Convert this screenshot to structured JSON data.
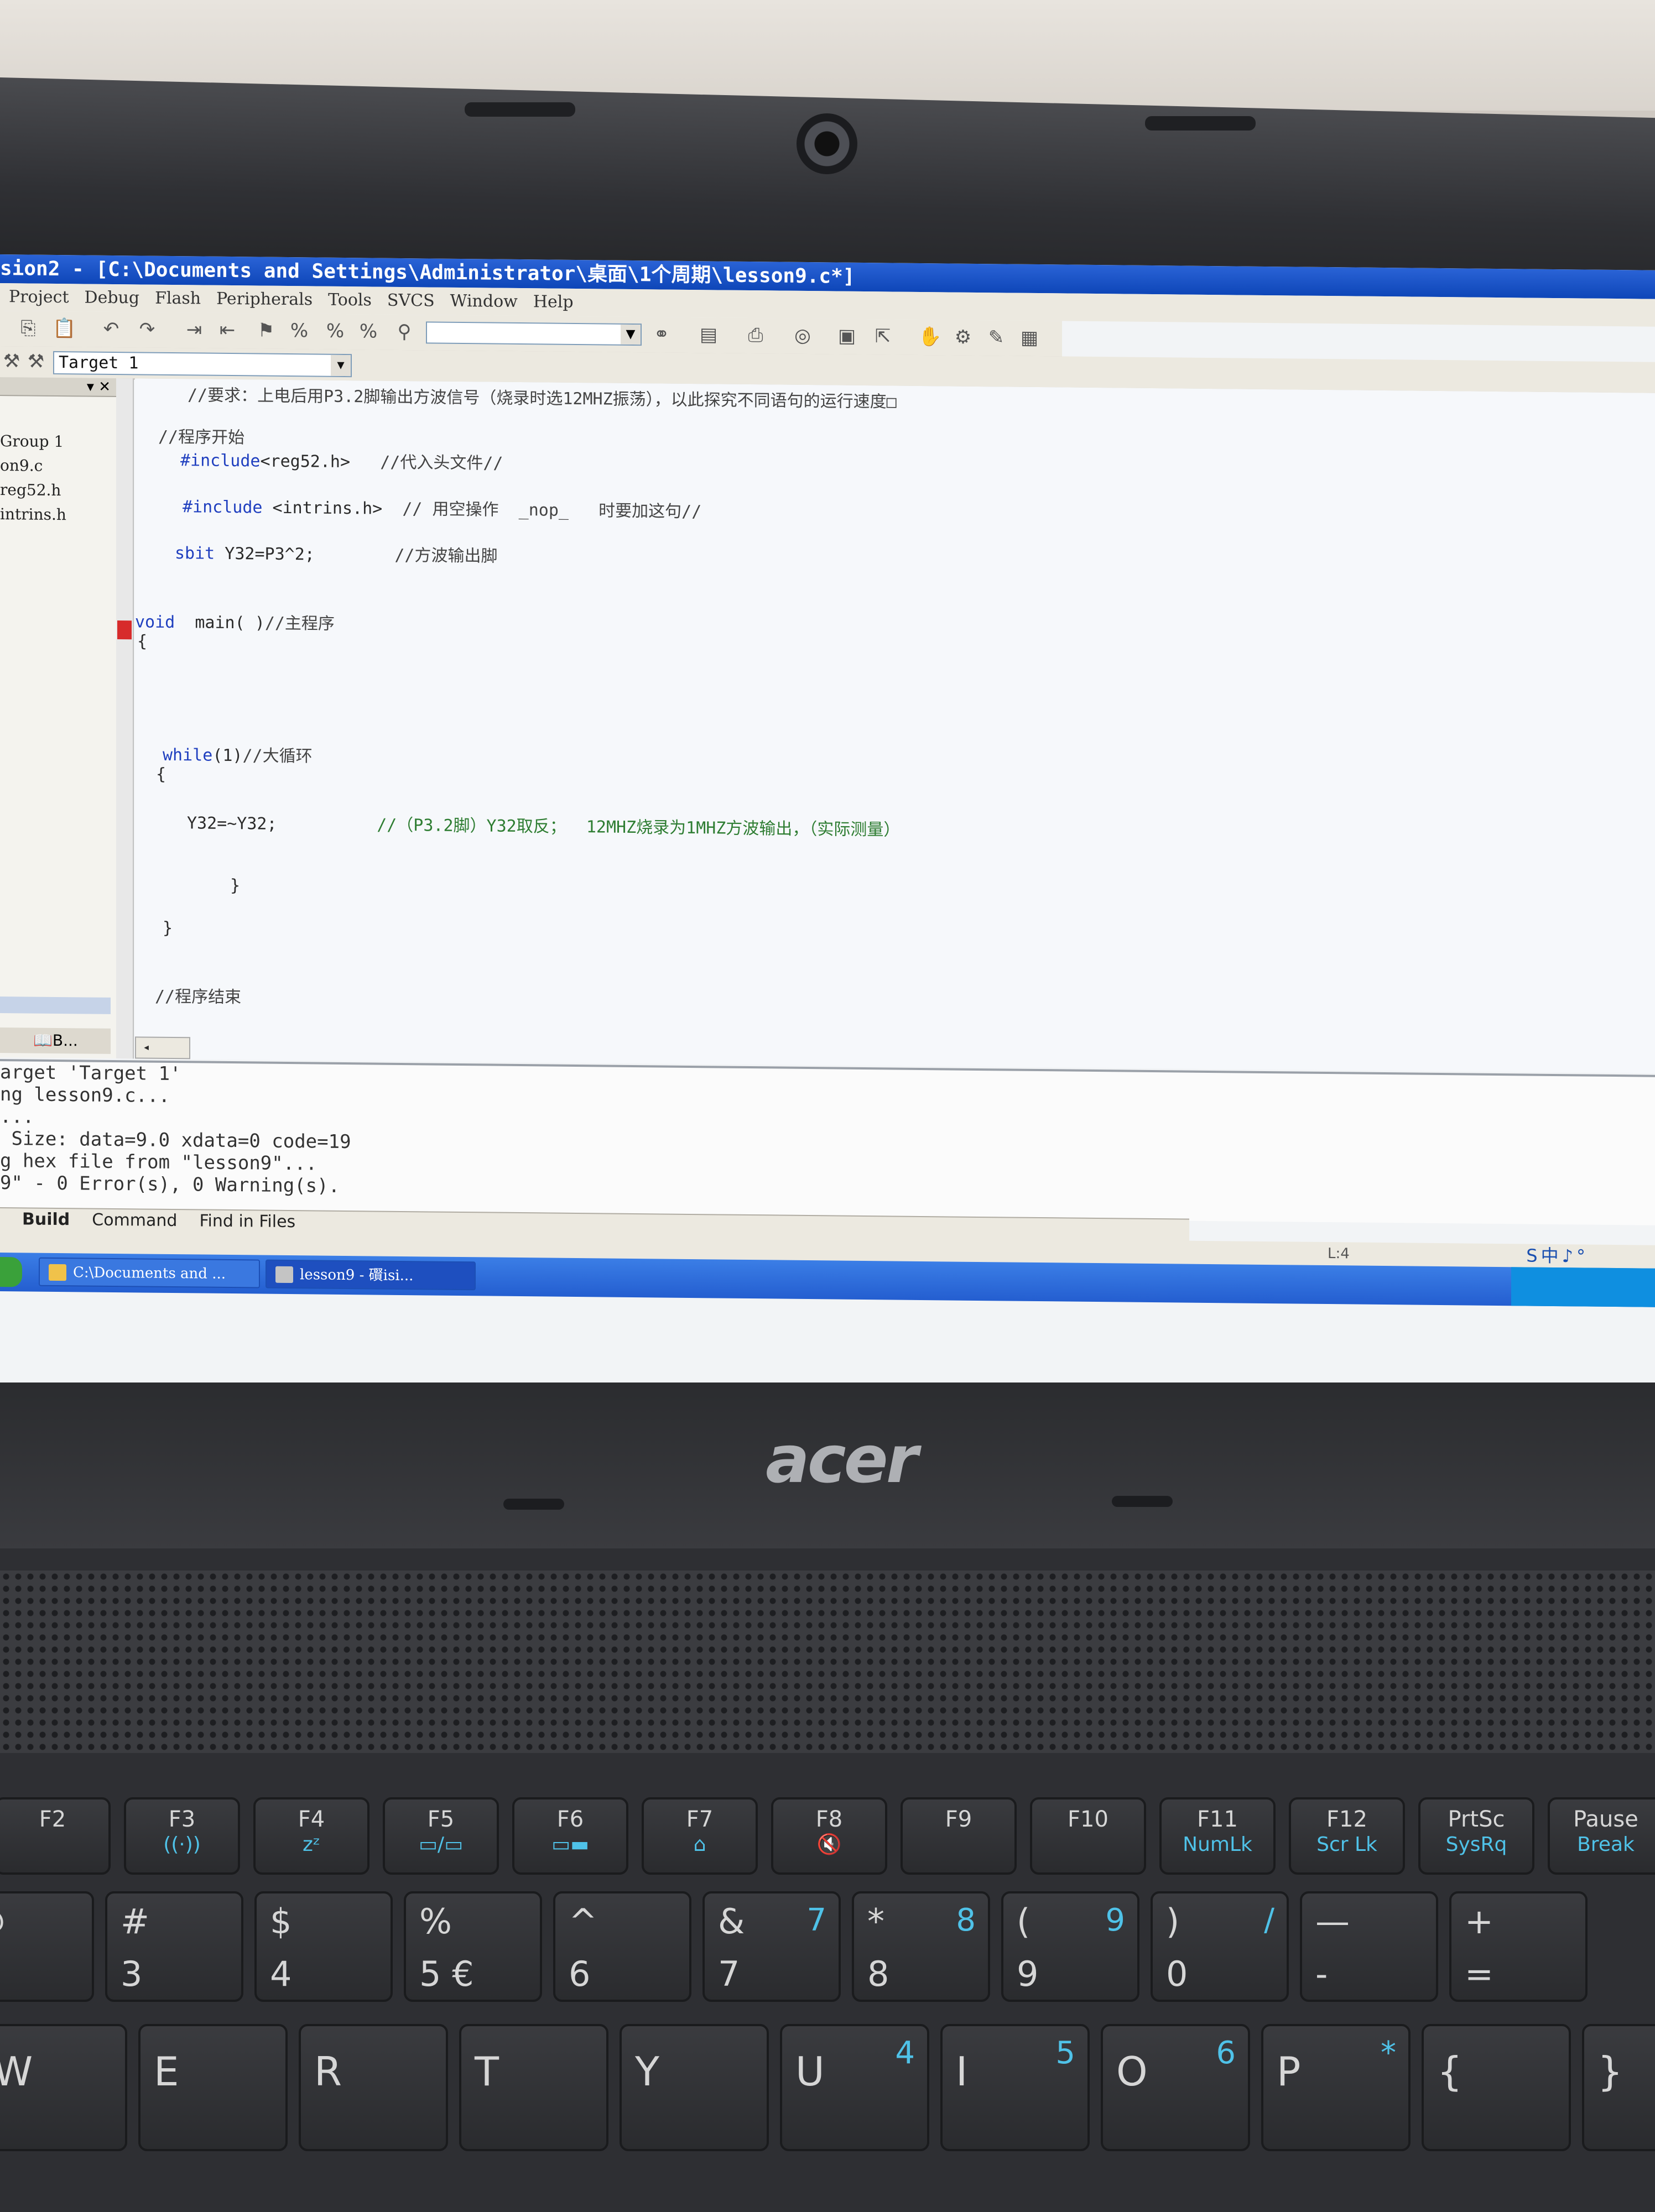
{
  "window": {
    "title": "sion2 - [C:\\Documents and Settings\\Administrator\\桌面\\1个周期\\lesson9.c*]"
  },
  "menu": [
    "Project",
    "Debug",
    "Flash",
    "Peripherals",
    "Tools",
    "SVCS",
    "Window",
    "Help"
  ],
  "toolbar": {
    "target": "Target 1"
  },
  "project_tree": {
    "items": [
      "Group 1",
      "on9.c",
      "reg52.h",
      "intrins.h"
    ],
    "tab_label": "B..."
  },
  "code": {
    "l1": "//要求：上电后用P3.2脚输出方波信号（烧录时选12MHZ振荡），以此探究不同语句的运行速度□",
    "l2": "//程序开始",
    "l3_kw": "#include",
    "l3_code": "<reg52.h>",
    "l3_cm": "//代入头文件//",
    "l4_kw": "#include",
    "l4_code": " <intrins.h>",
    "l4_cm": "// 用空操作  _nop_   时要加这句//",
    "l5_kw": "sbit",
    "l5_code": " Y32=P3^2;",
    "l5_cm": "//方波输出脚",
    "l6_kw": "void",
    "l6_code": "  main( )",
    "l6_cm": "//主程序",
    "l7": "{",
    "l8_kw": "while",
    "l8_code": "(1)",
    "l8_cm": "//大循环",
    "l9": "{",
    "l10_code": "Y32=~Y32;",
    "l10_cm": "//（P3.2脚）Y32取反；  12MHZ烧录为1MHZ方波输出，（实际测量）",
    "l11": "}",
    "l12": "}",
    "l13": "//程序结束"
  },
  "output": {
    "lines": [
      "arget 'Target 1'",
      "ng lesson9.c...",
      "...",
      " Size: data=9.0 xdata=0 code=19",
      "g hex file from \"lesson9\"...",
      "9\" - 0 Error(s), 0 Warning(s)."
    ],
    "tabs": [
      "Build",
      "Command",
      "Find in Files"
    ]
  },
  "status": {
    "position": "L:4",
    "ime": "S中♪°"
  },
  "taskbar": {
    "tasks": [
      "C:\\Documents and ...",
      "lesson9  - 礥isi..."
    ]
  },
  "laptop": {
    "brand": "acer"
  },
  "keyboard": {
    "fn_row": [
      {
        "k": "F2",
        "sub": ""
      },
      {
        "k": "F3",
        "sub": "((·))"
      },
      {
        "k": "F4",
        "sub": "zᶻ"
      },
      {
        "k": "F5",
        "sub": "▭/▭"
      },
      {
        "k": "F6",
        "sub": "▭▬"
      },
      {
        "k": "F7",
        "sub": "⌂"
      },
      {
        "k": "F8",
        "sub": "🔇"
      },
      {
        "k": "F9",
        "sub": ""
      },
      {
        "k": "F10",
        "sub": ""
      },
      {
        "k": "F11",
        "sub": "NumLk"
      },
      {
        "k": "F12",
        "sub": "Scr Lk"
      },
      {
        "k": "PrtSc",
        "sub": "SysRq"
      },
      {
        "k": "Pause",
        "sub": "Break"
      }
    ],
    "num_row": [
      {
        "top": "@",
        "bot": "",
        "blue": ""
      },
      {
        "top": "#",
        "bot": "3",
        "blue": ""
      },
      {
        "top": "$",
        "bot": "4",
        "blue": ""
      },
      {
        "top": "%",
        "bot": "5  €",
        "blue": ""
      },
      {
        "top": "^",
        "bot": "6",
        "blue": ""
      },
      {
        "top": "&",
        "bot": "7",
        "blue": "7"
      },
      {
        "top": "*",
        "bot": "8",
        "blue": "8"
      },
      {
        "top": "(",
        "bot": "9",
        "blue": "9"
      },
      {
        "top": ")",
        "bot": "0",
        "blue": "/"
      },
      {
        "top": "—",
        "bot": "-",
        "blue": ""
      },
      {
        "top": "+",
        "bot": "=",
        "blue": ""
      }
    ],
    "letter_row": [
      {
        "top": "W",
        "blue": ""
      },
      {
        "top": "E",
        "blue": ""
      },
      {
        "top": "R",
        "blue": ""
      },
      {
        "top": "T",
        "blue": ""
      },
      {
        "top": "Y",
        "blue": ""
      },
      {
        "top": "U",
        "blue": "4"
      },
      {
        "top": "I",
        "blue": "5"
      },
      {
        "top": "O",
        "blue": "6"
      },
      {
        "top": "P",
        "blue": "*"
      },
      {
        "top": "{",
        "blue": ""
      },
      {
        "top": "}",
        "blue": ""
      }
    ]
  }
}
